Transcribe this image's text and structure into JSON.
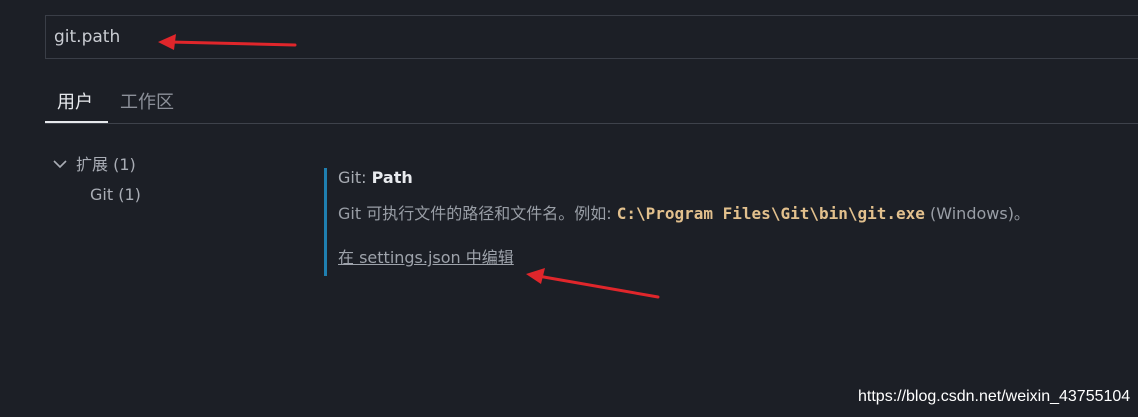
{
  "search": {
    "value": "git.path"
  },
  "tabs": [
    {
      "label": "用户",
      "active": true
    },
    {
      "label": "工作区",
      "active": false
    }
  ],
  "tree": {
    "category": {
      "label": "扩展 (1)",
      "expanded": true,
      "icon": "chevron-down-icon"
    },
    "items": [
      {
        "label": "Git (1)"
      }
    ]
  },
  "setting": {
    "category": "Git: ",
    "name": "Path",
    "description_prefix": "Git 可执行文件的路径和文件名。例如: ",
    "description_code": "C:\\Program Files\\Git\\bin\\git.exe",
    "description_suffix": " (Windows)。",
    "link_label": "在 settings.json 中编辑"
  },
  "watermark": "https://blog.csdn.net/weixin_43755104",
  "colors": {
    "background": "#1c1f26",
    "accent_bar": "#1f7fb0",
    "code": "#e2c08d",
    "annotation_arrow": "#e0262b"
  }
}
